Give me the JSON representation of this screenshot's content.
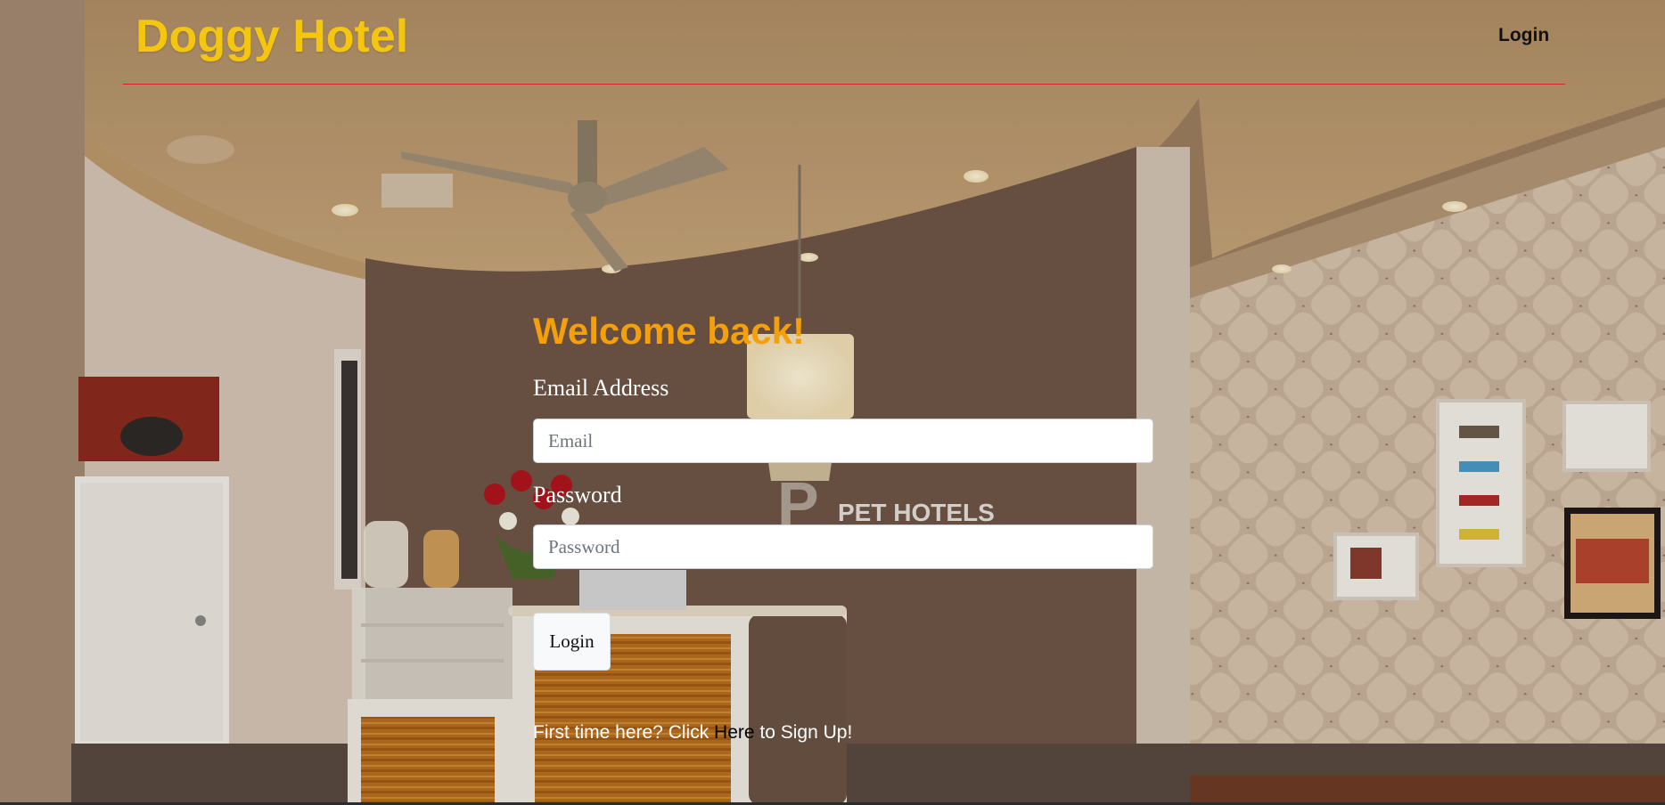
{
  "header": {
    "brand": "Doggy Hotel",
    "nav_login": "Login",
    "brand_color": "#f5c60f",
    "rule_color": "#d8241a"
  },
  "background": {
    "sign_text": "PET HOTELS"
  },
  "login_form": {
    "heading": "Welcome back!",
    "heading_color": "#f5a00a",
    "email_label": "Email Address",
    "email_placeholder": "Email",
    "email_value": "",
    "password_label": "Password",
    "password_placeholder": "Password",
    "password_value": "",
    "submit_label": "Login",
    "signup_prefix": "First time here? Click ",
    "signup_link": "Here",
    "signup_suffix": " to Sign Up!"
  }
}
